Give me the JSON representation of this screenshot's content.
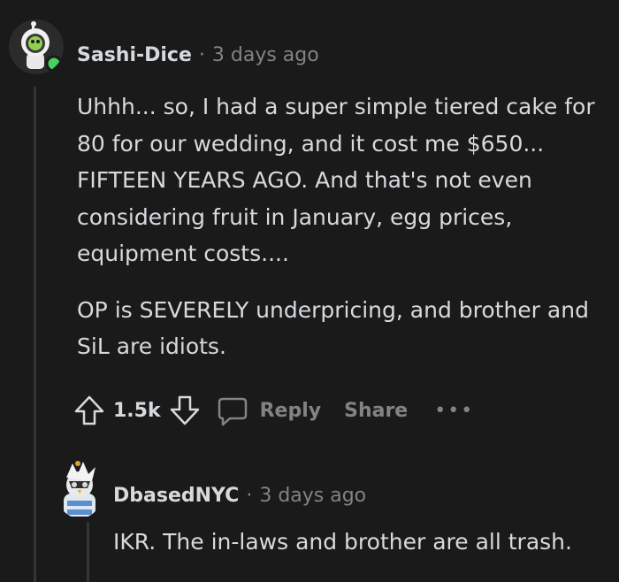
{
  "comment": {
    "username": "Sashi-Dice",
    "separator": "·",
    "time": "3 days ago",
    "paragraphs": [
      "Uhhh... so, I had a super simple tiered cake for 80 for our wedding, and it cost me $650... FIFTEEN YEARS AGO. And that's not even considering fruit in January, egg prices, equipment costs....",
      "OP is SEVERELY underpricing, and brother and SiL are idiots."
    ],
    "score": "1.5k",
    "reply_label": "Reply",
    "share_label": "Share",
    "more_label": "•••"
  },
  "reply": {
    "username": "DbasedNYC",
    "separator": "·",
    "time": "3 days ago",
    "text": "IKR. The in-laws and brother are all trash."
  },
  "colors": {
    "background": "#1a1a1b",
    "text": "#d7dadc",
    "muted": "#818384",
    "online": "#46d160"
  },
  "icons": [
    "astronaut-avatar-icon",
    "upvote-icon",
    "downvote-icon",
    "comment-icon",
    "more-icon",
    "owl-avatar-icon"
  ]
}
